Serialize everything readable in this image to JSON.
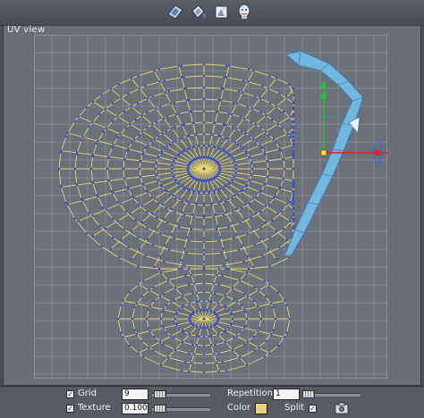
{
  "panel": {
    "title": "UV view"
  },
  "toolbar": {
    "icons": [
      "uv-layout-icon",
      "paint-bucket-icon",
      "texture-unwrap-icon",
      "head-model-icon"
    ]
  },
  "controls": {
    "grid_label": "Grid",
    "grid_checked": true,
    "grid_value": "9",
    "texture_label": "Texture",
    "texture_checked": true,
    "texture_value": "0.100",
    "repetition_label": "Repetition",
    "repetition_value": "1",
    "color_label": "Color",
    "color_value": "#e8d27a",
    "split_label": "Split",
    "split_checked": true,
    "camera_icon": "camera-icon"
  },
  "colors": {
    "mesh_edge": "#e8d86a",
    "mesh_vertex": "#3a4fd0",
    "selection_fill": "#6fb4dc",
    "grid_line": "#9aa0a8",
    "axis_x": "#e0231f",
    "axis_y": "#22c33a",
    "axis_z": "#3a62e0"
  }
}
